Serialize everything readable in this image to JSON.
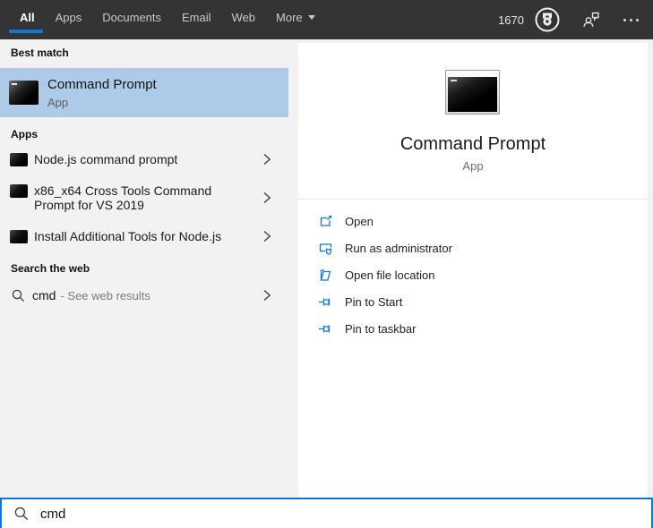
{
  "topbar": {
    "tabs": [
      {
        "label": "All"
      },
      {
        "label": "Apps"
      },
      {
        "label": "Documents"
      },
      {
        "label": "Email"
      },
      {
        "label": "Web"
      },
      {
        "label": "More"
      }
    ],
    "rewards_points": "1670"
  },
  "left_panel": {
    "best_match_header": "Best match",
    "best_match": {
      "title": "Command Prompt",
      "type": "App"
    },
    "apps_header": "Apps",
    "apps": [
      {
        "label": "Node.js command prompt"
      },
      {
        "label": "x86_x64 Cross Tools Command Prompt for VS 2019"
      },
      {
        "label": "Install Additional Tools for Node.js"
      }
    ],
    "web_header": "Search the web",
    "web_result": {
      "query": "cmd",
      "suffix": "- See web results"
    }
  },
  "preview_panel": {
    "title": "Command Prompt",
    "type": "App",
    "actions": [
      {
        "label": "Open"
      },
      {
        "label": "Run as administrator"
      },
      {
        "label": "Open file location"
      },
      {
        "label": "Pin to Start"
      },
      {
        "label": "Pin to taskbar"
      }
    ]
  },
  "search_bar": {
    "value": "cmd"
  },
  "colors": {
    "accent": "#0f78d4",
    "topbar_bg": "#343434",
    "panel_bg": "#f2f2f2",
    "highlight": "#adcbe8",
    "action_icon": "#0f78d4"
  }
}
